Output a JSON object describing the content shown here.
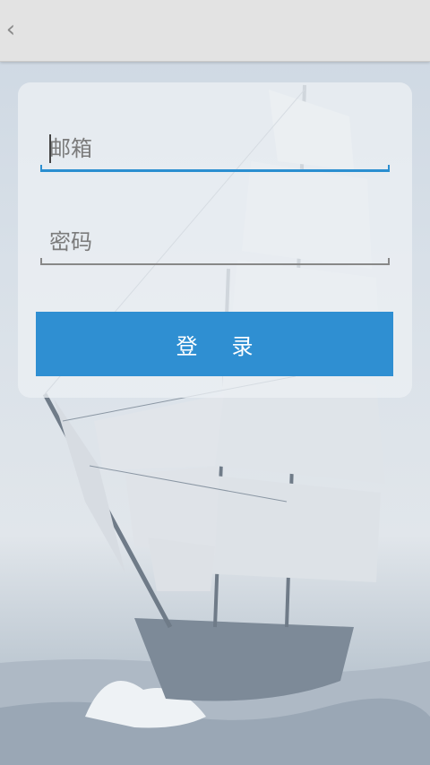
{
  "form": {
    "email_placeholder": "邮箱",
    "password_placeholder": "密码",
    "login_label": "登录"
  },
  "colors": {
    "accent": "#2f8fd2",
    "topbar": "#e3e3e3"
  },
  "icons": {
    "back": "chevron-left-icon"
  }
}
